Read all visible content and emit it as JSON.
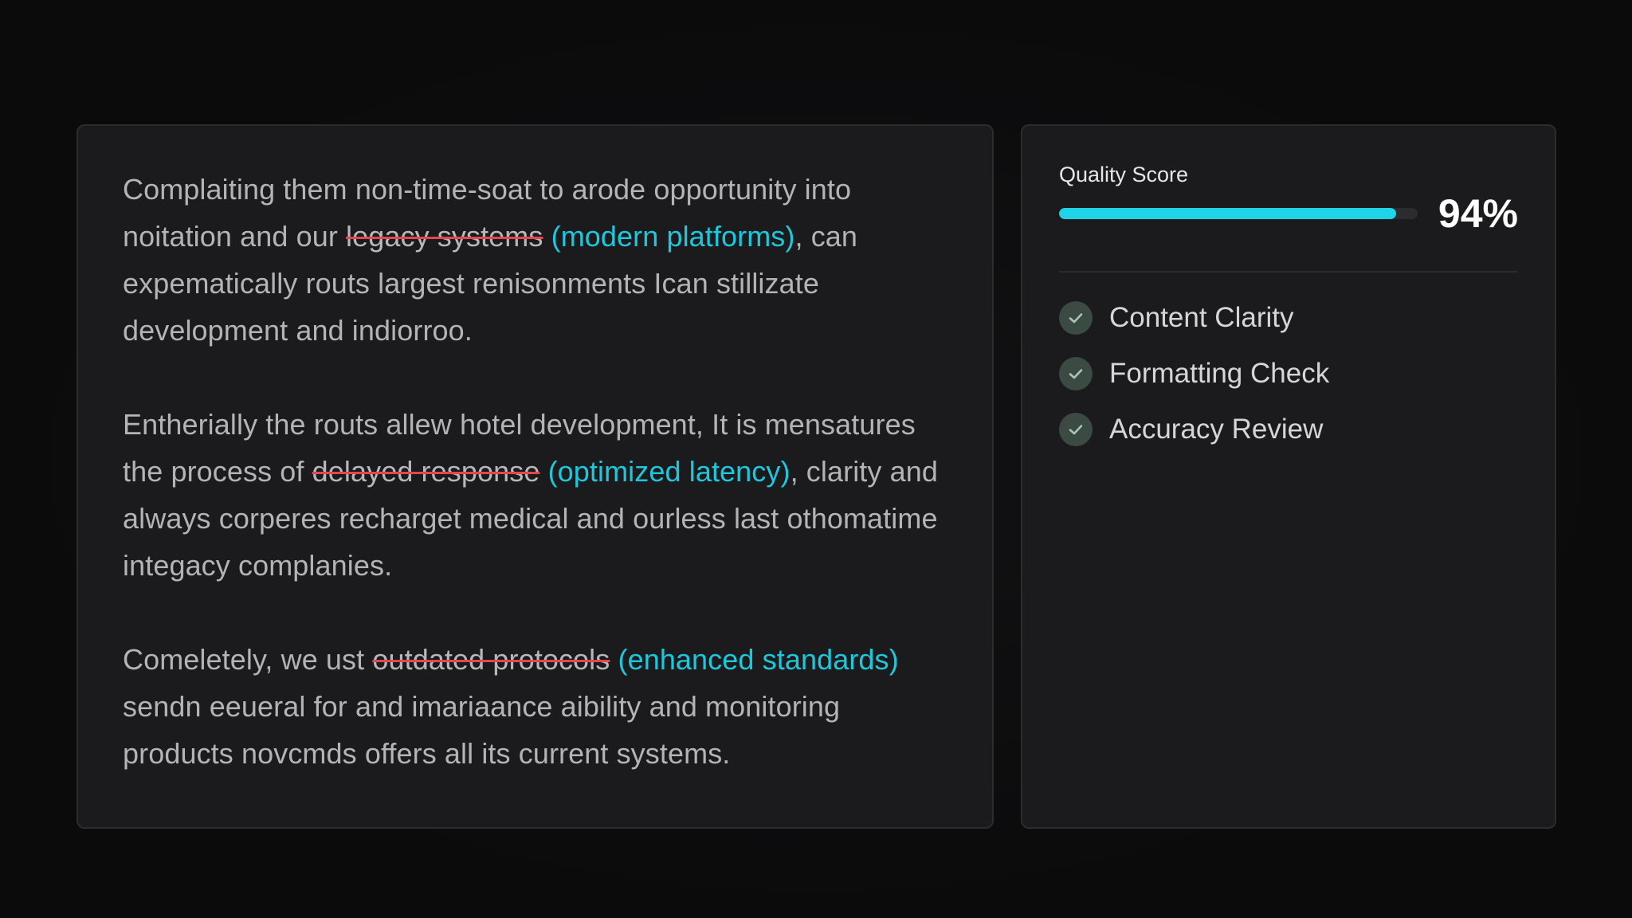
{
  "editor": {
    "paragraphs": [
      {
        "segments": [
          {
            "type": "text",
            "text": "Complaiting them non-time-soat to arode opportunity into noitation and our "
          },
          {
            "type": "removed",
            "text": "legacy systems"
          },
          {
            "type": "text",
            "text": " "
          },
          {
            "type": "added",
            "text": "(modern platforms)"
          },
          {
            "type": "text",
            "text": ", can expematically routs largest renisonments Ican stillizate development and indiorroo."
          }
        ]
      },
      {
        "segments": [
          {
            "type": "text",
            "text": "Entherially the routs allew hotel development, It is mensatures the process of "
          },
          {
            "type": "removed",
            "text": "delayed response"
          },
          {
            "type": "text",
            "text": " "
          },
          {
            "type": "added",
            "text": "(optimized latency)"
          },
          {
            "type": "text",
            "text": ", clarity and always corperes recharget medical and ourless last othomatime integacy complanies."
          }
        ]
      },
      {
        "segments": [
          {
            "type": "text",
            "text": "Comeletely, we ust "
          },
          {
            "type": "removed",
            "text": "outdated protocols"
          },
          {
            "type": "text",
            "text": " "
          },
          {
            "type": "added",
            "text": "(enhanced standards)"
          },
          {
            "type": "text",
            "text": " sendn eeueral for and imariaance aibility and monitoring products novcmds offers all its current systems."
          }
        ]
      }
    ]
  },
  "quality": {
    "label": "Quality Score",
    "value_text": "94%",
    "progress_fraction": 0.94
  },
  "checks": [
    {
      "label": "Content Clarity",
      "status": "passed"
    },
    {
      "label": "Formatting Check",
      "status": "passed"
    },
    {
      "label": "Accuracy Review",
      "status": "passed"
    }
  ],
  "colors": {
    "accent": "#1fd4e6",
    "added_text": "#1ec8dc",
    "strike_line": "#e2474b",
    "check_badge": "#3b4a42",
    "check_mark": "#a9c7b4"
  },
  "icons": {
    "check": "check-circle-icon"
  }
}
